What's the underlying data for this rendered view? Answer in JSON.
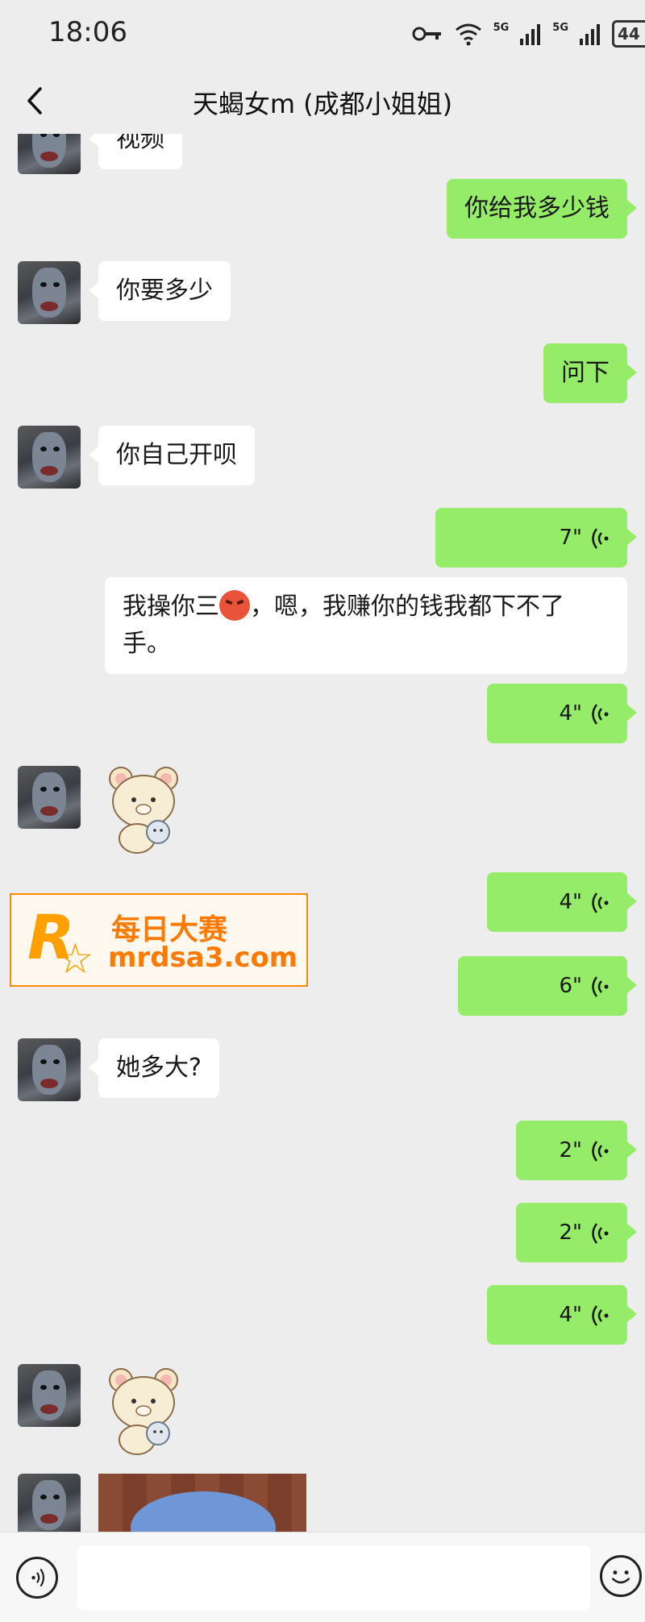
{
  "status_bar": {
    "time": "18:06",
    "net_1": "5G",
    "net_2": "5G",
    "battery": "44",
    "icons": [
      "key-icon",
      "wifi-icon",
      "signal-icon",
      "signal-icon",
      "battery-icon"
    ]
  },
  "nav": {
    "title": "天蝎女m (成都小姐姐)",
    "back_icon": "chevron-left-icon"
  },
  "messages": [
    {
      "side": "left",
      "type": "text",
      "text": "视频"
    },
    {
      "side": "right",
      "type": "text",
      "text": "你给我多少钱"
    },
    {
      "side": "left",
      "type": "text",
      "text": "你要多少"
    },
    {
      "side": "right",
      "type": "text",
      "text": "问下"
    },
    {
      "side": "left",
      "type": "text",
      "text": "你自己开呗"
    },
    {
      "side": "right",
      "type": "voice",
      "duration": "7\""
    },
    {
      "side": "right",
      "type": "text",
      "text_before": "我操你三",
      "emoji": "angry-face-emoji",
      "text_after": "，嗯，我赚你的钱我都下不了手。"
    },
    {
      "side": "right",
      "type": "voice",
      "duration": "4\""
    },
    {
      "side": "left",
      "type": "sticker",
      "sticker": "bear-sticker"
    },
    {
      "side": "right",
      "type": "voice",
      "duration": "4\""
    },
    {
      "side": "right",
      "type": "voice",
      "duration": "6\""
    },
    {
      "side": "left",
      "type": "text",
      "text": "她多大?"
    },
    {
      "side": "right",
      "type": "voice",
      "duration": "2\""
    },
    {
      "side": "right",
      "type": "voice",
      "duration": "2\""
    },
    {
      "side": "right",
      "type": "voice",
      "duration": "4\""
    },
    {
      "side": "left",
      "type": "sticker",
      "sticker": "bear-sticker"
    },
    {
      "side": "left",
      "type": "image"
    }
  ],
  "watermark": {
    "letter": "R",
    "brand_cn": "每日大赛",
    "url": "mrdsa3.com",
    "color": "#ff7a00"
  },
  "input_bar": {
    "placeholder": "",
    "voice_icon": "voice-icon",
    "emoji_icon": "emoji-icon"
  },
  "colors": {
    "background": "#ededed",
    "my_bubble": "#95ec69",
    "their_bubble": "#ffffff"
  }
}
